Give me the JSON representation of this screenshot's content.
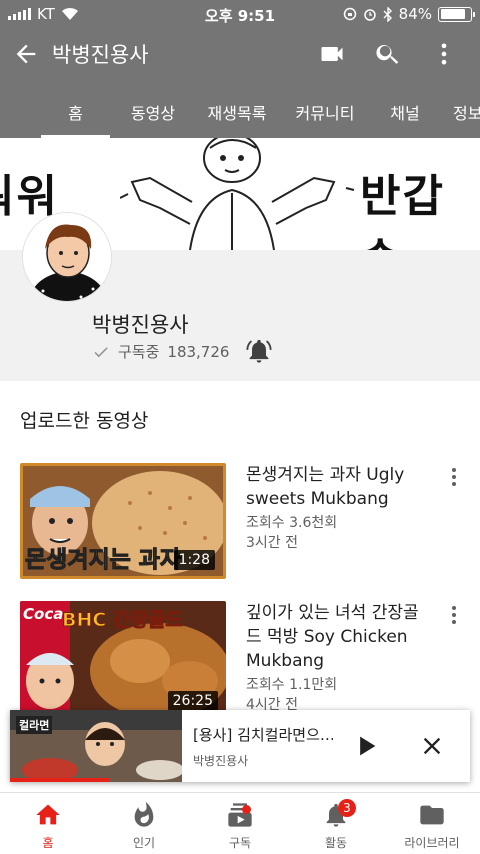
{
  "status": {
    "carrier": "KT",
    "time": "오후 9:51",
    "battery": "84%",
    "battery_level": 0.84
  },
  "appbar": {
    "title": "박병진용사"
  },
  "tabs": [
    "홈",
    "동영상",
    "재생목록",
    "커뮤니티",
    "채널",
    "정보"
  ],
  "banner": {
    "text_left": "워워",
    "text_right": "반갑습"
  },
  "channel": {
    "name": "박병진용사",
    "subscribed_label": "구독중",
    "subscribers": "183,726"
  },
  "section": {
    "title": "업로드한 동영상"
  },
  "videos": [
    {
      "title": "몬생겨지는 과자 Ugly sweets Mukbang",
      "views": "조회수 3.6천회",
      "age": "3시간 전",
      "duration": "1:28",
      "thumb_caption": "몬생겨지는 과자"
    },
    {
      "title": "깊이가 있는 녀석 간장골드 먹방 Soy Chicken Mukbang",
      "views": "조회수 1.1만회",
      "age": "4시간 전",
      "duration": "26:25",
      "thumb_caption": "BHC 간장골드",
      "thumb_brand": "Coca"
    }
  ],
  "mini_player": {
    "title": "[용사] 김치컬라면으…",
    "channel": "박병진용사",
    "thumb_caption": "컬라면"
  },
  "bottom_nav": [
    {
      "label": "홈",
      "active": true
    },
    {
      "label": "인기"
    },
    {
      "label": "구독",
      "dot": true
    },
    {
      "label": "활동",
      "badge": "3"
    },
    {
      "label": "라이브러리"
    }
  ],
  "colors": {
    "appbar": "#757575",
    "accent": "#e62117"
  }
}
